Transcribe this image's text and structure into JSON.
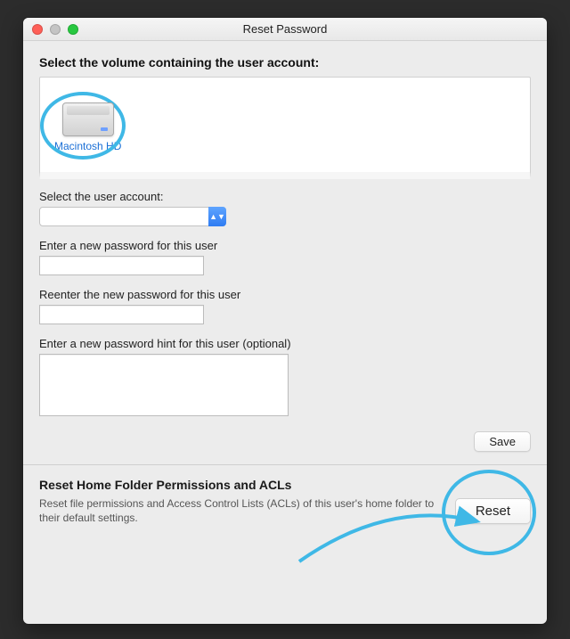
{
  "window": {
    "title": "Reset Password"
  },
  "volume": {
    "label": "Select the volume containing the user account:",
    "items": [
      {
        "name": "Macintosh HD"
      }
    ]
  },
  "user_account": {
    "label": "Select the user account:",
    "value": ""
  },
  "new_password": {
    "label": "Enter a new password for this user",
    "value": ""
  },
  "reenter_password": {
    "label": "Reenter the new password for this user",
    "value": ""
  },
  "hint": {
    "label": "Enter a new password hint for this user (optional)",
    "value": ""
  },
  "buttons": {
    "save": "Save",
    "reset": "Reset"
  },
  "acl": {
    "title": "Reset Home Folder Permissions and ACLs",
    "desc": "Reset file permissions and Access Control Lists (ACLs) of this user's home folder to their default settings."
  },
  "annotation": {
    "color": "#3fb8e6"
  }
}
